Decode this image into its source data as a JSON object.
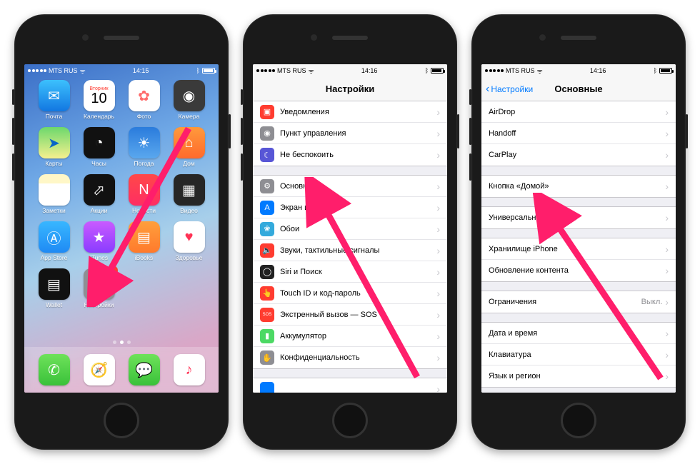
{
  "carrier": "MTS RUS",
  "bluetooth_glyph": "ᛒ",
  "phones": {
    "one": {
      "time": "14:15"
    },
    "two": {
      "time": "14:16",
      "title": "Настройки"
    },
    "three": {
      "time": "14:16",
      "title": "Основные",
      "back": "Настройки"
    }
  },
  "home": {
    "apps": [
      {
        "label": "Почта",
        "bg": "linear-gradient(#3cc0fd,#1277e1)",
        "glyph": "✉"
      },
      {
        "label": "Календарь",
        "type": "calendar",
        "dow": "Вторник",
        "day": "10"
      },
      {
        "label": "Фото",
        "bg": "#fff",
        "glyph": "✿",
        "fg": "#ff6b6b"
      },
      {
        "label": "Камера",
        "bg": "#3a3a3a",
        "glyph": "◉"
      },
      {
        "label": "Карты",
        "bg": "linear-gradient(#6cd86c,#f6f08e)",
        "glyph": "➤",
        "fg": "#0864c7"
      },
      {
        "label": "Часы",
        "bg": "#111",
        "glyph": "◔"
      },
      {
        "label": "Погода",
        "bg": "linear-gradient(#2a7bdc,#5aa7ee)",
        "glyph": "☀"
      },
      {
        "label": "Дом",
        "bg": "linear-gradient(#ff9a3c,#ff6a2c)",
        "glyph": "⌂"
      },
      {
        "label": "Заметки",
        "bg": "linear-gradient(#fff7c7 30%,#fff 30%)",
        "glyph": "",
        "fg": "#999"
      },
      {
        "label": "Акции",
        "bg": "#111",
        "glyph": "⬀"
      },
      {
        "label": "Новости",
        "bg": "linear-gradient(#ff4848,#ff2e63)",
        "glyph": "N"
      },
      {
        "label": "Видео",
        "bg": "#262626",
        "glyph": "▦"
      },
      {
        "label": "App Store",
        "bg": "linear-gradient(#38b7ff,#1f8af4)",
        "glyph": "Ⓐ"
      },
      {
        "label": "iTunes",
        "bg": "linear-gradient(#c95bff,#8a3cff)",
        "glyph": "★"
      },
      {
        "label": "iBooks",
        "bg": "linear-gradient(#ff9f3c,#ff7a2c)",
        "glyph": "▤"
      },
      {
        "label": "Здоровье",
        "bg": "#fff",
        "glyph": "♥",
        "fg": "#ff3355"
      },
      {
        "label": "Wallet",
        "bg": "#111",
        "glyph": "▤"
      },
      {
        "label": "Настройки",
        "bg": "#8e8e93",
        "glyph": "⚙",
        "badge": "1"
      }
    ],
    "dock": [
      {
        "name": "phone",
        "bg": "linear-gradient(#6ee25a,#3ac13a)",
        "glyph": "✆"
      },
      {
        "name": "safari",
        "bg": "#fff",
        "glyph": "🧭",
        "fg": "#1d8bf1"
      },
      {
        "name": "messages",
        "bg": "linear-gradient(#6ee25a,#3ac13a)",
        "glyph": "💬"
      },
      {
        "name": "music",
        "bg": "#fff",
        "glyph": "♪",
        "fg": "#ff3355"
      }
    ]
  },
  "settings_groups": [
    [
      {
        "label": "Уведомления",
        "bg": "#ff3c30",
        "glyph": "▣"
      },
      {
        "label": "Пункт управления",
        "bg": "#8e8e93",
        "glyph": "◉"
      },
      {
        "label": "Не беспокоить",
        "bg": "#5856d6",
        "glyph": "☾"
      }
    ],
    [
      {
        "label": "Основные",
        "bg": "#8e8e93",
        "glyph": "⚙"
      },
      {
        "label": "Экран и яркость",
        "bg": "#007aff",
        "glyph": "A"
      },
      {
        "label": "Обои",
        "bg": "#34aadc",
        "glyph": "❀"
      },
      {
        "label": "Звуки, тактильные сигналы",
        "bg": "#ff3c30",
        "glyph": "🔈"
      },
      {
        "label": "Siri и Поиск",
        "bg": "#222",
        "glyph": "◯"
      },
      {
        "label": "Touch ID и код-пароль",
        "bg": "#ff3c30",
        "glyph": "👆"
      },
      {
        "label": "Экстренный вызов — SOS",
        "bg": "#ff3c30",
        "glyph": "SOS",
        "small": true
      },
      {
        "label": "Аккумулятор",
        "bg": "#4cd964",
        "glyph": "▮"
      },
      {
        "label": "Конфиденциальность",
        "bg": "#8e8e93",
        "glyph": "✋"
      }
    ],
    [
      {
        "label": "",
        "bg": "#007aff",
        "glyph": ""
      }
    ]
  ],
  "general_groups": [
    [
      {
        "label": "AirDrop"
      },
      {
        "label": "Handoff"
      },
      {
        "label": "CarPlay"
      }
    ],
    [
      {
        "label": "Кнопка «Домой»"
      }
    ],
    [
      {
        "label": "Универсальный доступ"
      }
    ],
    [
      {
        "label": "Хранилище iPhone"
      },
      {
        "label": "Обновление контента"
      }
    ],
    [
      {
        "label": "Ограничения",
        "value": "Выкл."
      }
    ],
    [
      {
        "label": "Дата и время"
      },
      {
        "label": "Клавиатура"
      },
      {
        "label": "Язык и регион"
      }
    ]
  ]
}
